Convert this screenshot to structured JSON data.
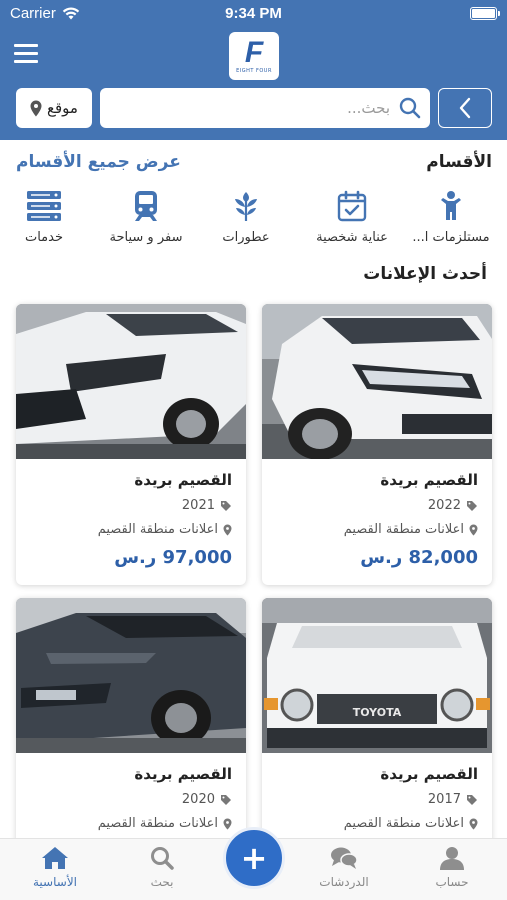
{
  "status_bar": {
    "carrier": "Carrier",
    "time": "9:34 PM"
  },
  "header": {
    "logo_text": "EIGHT FOUR",
    "search_placeholder": "بحث...",
    "location_label": "موقع"
  },
  "categories_section": {
    "title": "الأقسام",
    "view_all": "عرض جميع الأقسام",
    "items": [
      {
        "label": "مستلزمات ا...",
        "icon": "child-icon"
      },
      {
        "label": "عناية شخصية",
        "icon": "calendar-check-icon"
      },
      {
        "label": "عطورات",
        "icon": "leaf-branch-icon"
      },
      {
        "label": "سفر و سياحة",
        "icon": "train-icon"
      },
      {
        "label": "خدمات",
        "icon": "server-icon"
      }
    ]
  },
  "latest_section": {
    "title": "أحدث الإعلانات"
  },
  "listings": [
    {
      "title": "القصيم بريدة",
      "year": "2022",
      "location": "اعلانات منطقة القصيم",
      "price": "82,000 ر.س",
      "image": "white-suv-front"
    },
    {
      "title": "القصيم بريدة",
      "year": "2021",
      "location": "اعلانات منطقة القصيم",
      "price": "97,000 ر.س",
      "image": "white-rav4-front"
    },
    {
      "title": "القصيم بريدة",
      "year": "2017",
      "location": "اعلانات منطقة القصيم",
      "price": "",
      "image": "white-fj-cruiser-front"
    },
    {
      "title": "القصيم بريدة",
      "year": "2020",
      "location": "اعلانات منطقة القصيم",
      "price": "",
      "image": "dark-kona-front"
    }
  ],
  "bottom_nav": {
    "items": [
      {
        "label": "حساب",
        "icon": "user-icon"
      },
      {
        "label": "الدردشات",
        "icon": "chat-icon"
      },
      {
        "label": "بحث",
        "icon": "search-icon"
      },
      {
        "label": "الأساسية",
        "icon": "home-icon"
      }
    ],
    "fab_label": "+"
  },
  "colors": {
    "primary": "#4474b3",
    "price": "#2d5fa8",
    "fab": "#2f6dc7"
  }
}
